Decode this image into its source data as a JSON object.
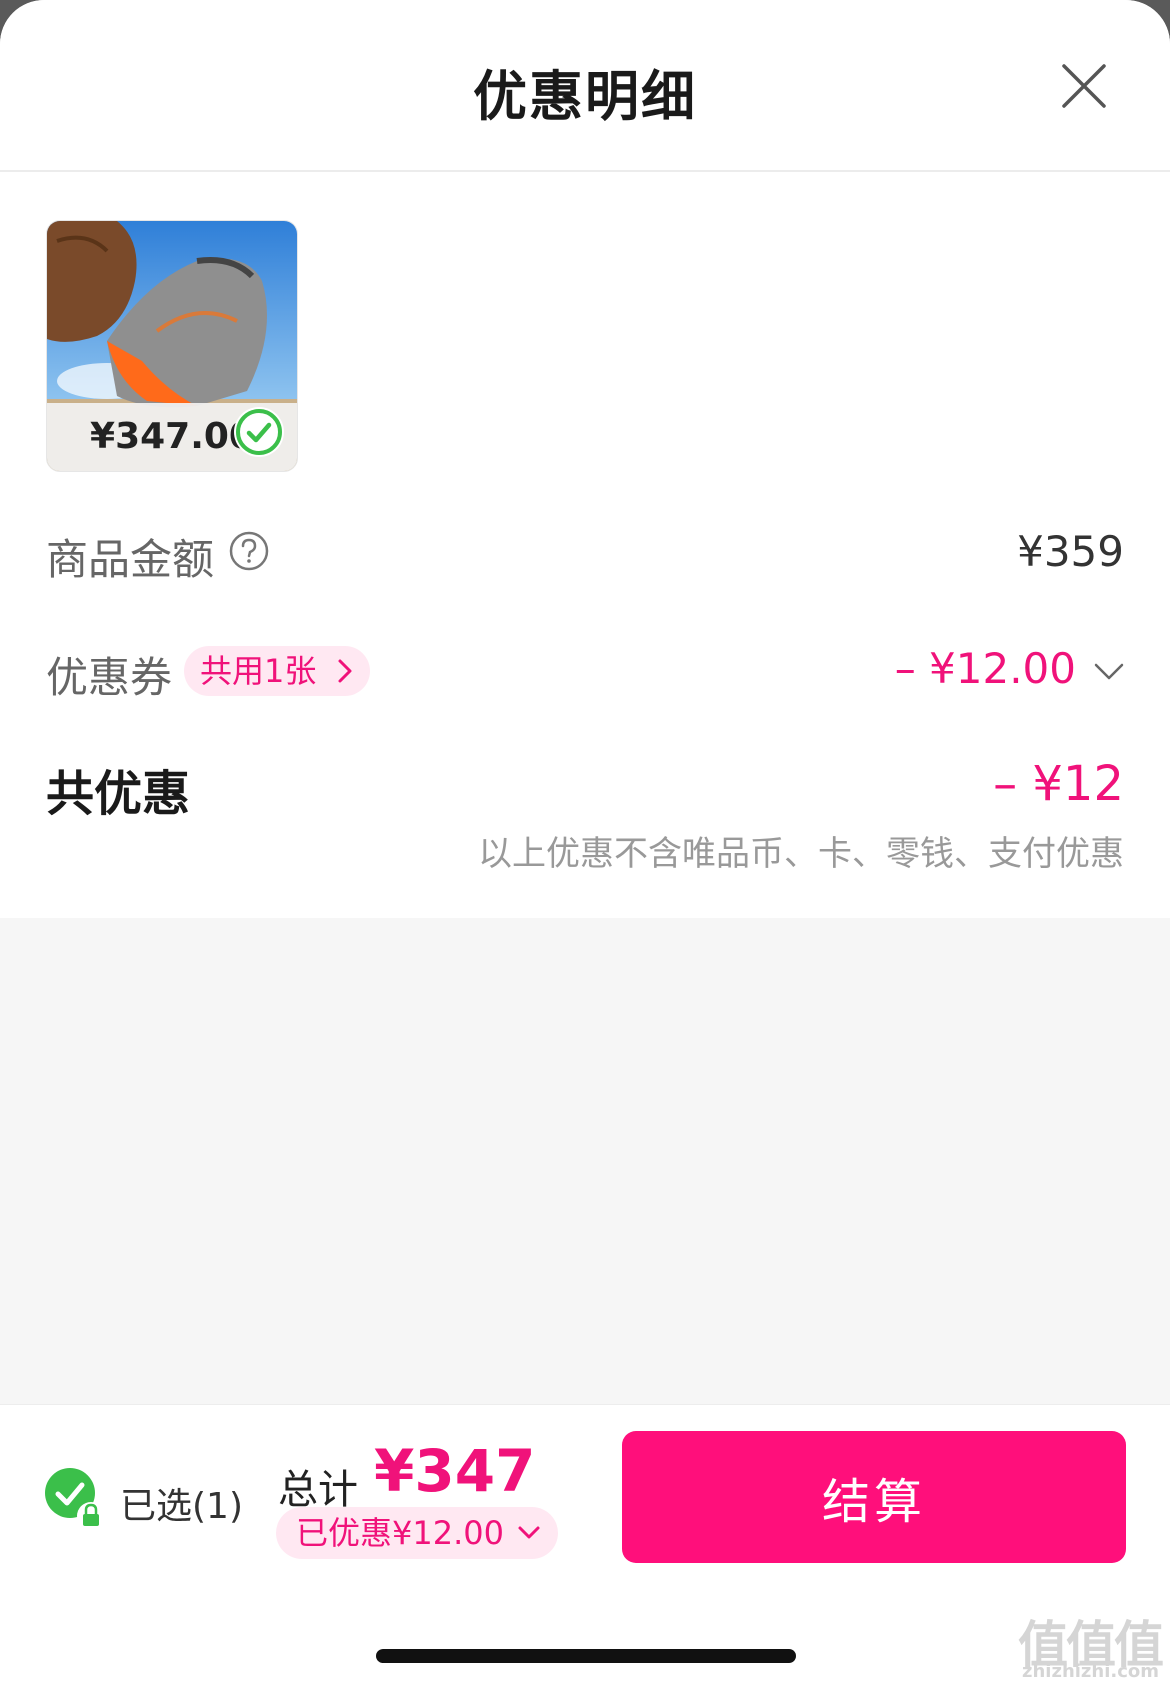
{
  "header": {
    "title": "优惠明细",
    "close_icon": "close-icon"
  },
  "product": {
    "price": "¥347.00",
    "selected": true,
    "image": "trail running shoe on rock"
  },
  "amount_row": {
    "label": "商品金额",
    "value": "¥359",
    "help_icon": "question-circle-icon"
  },
  "coupon_row": {
    "label": "优惠券",
    "pill_text": "共用1张",
    "value": "– ¥12.00"
  },
  "total_discount_row": {
    "label": "共优惠",
    "value": "– ¥12",
    "note": "以上优惠不含唯品币、卡、零钱、支付优惠"
  },
  "bottom_bar": {
    "selected_text": "已选(1)",
    "total_label": "总计",
    "total_value": "¥347",
    "saved_text": "已优惠¥12.00",
    "checkout_label": "结算"
  },
  "watermark": {
    "main": "值值值",
    "sub": "zhizhizhi.com"
  },
  "colors": {
    "accent": "#ff0f7b",
    "accent_text": "#f0127a",
    "pill_bg": "#ffe8f2",
    "check_green": "#3bbf4a"
  }
}
